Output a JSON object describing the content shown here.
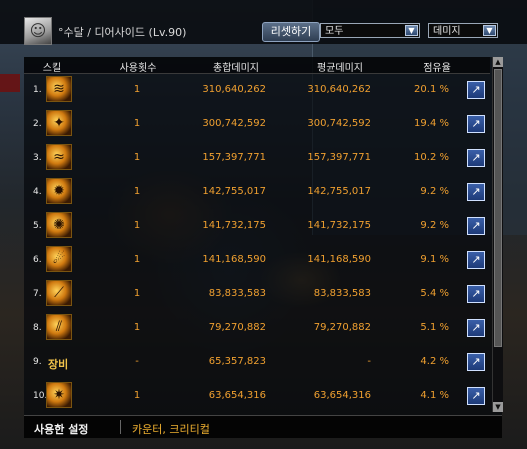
{
  "header": {
    "character": "°수달 / 디어사이드 (Lv.90)",
    "reset_label": "리셋하기",
    "filter_select": "모두",
    "metric_select": "데미지"
  },
  "table": {
    "columns": [
      "스킬",
      "사용횟수",
      "총합데미지",
      "평균데미지",
      "점유율"
    ],
    "rows": [
      {
        "rank": "1.",
        "icon": "fire-claw-icon",
        "skill_text": "",
        "uses": "1",
        "total": "310,640,262",
        "avg": "310,640,262",
        "share": "20.1 %"
      },
      {
        "rank": "2.",
        "icon": "dragon-head-icon",
        "skill_text": "",
        "uses": "1",
        "total": "300,742,592",
        "avg": "300,742,592",
        "share": "19.4 %"
      },
      {
        "rank": "3.",
        "icon": "slash-wave-icon",
        "skill_text": "",
        "uses": "1",
        "total": "157,397,771",
        "avg": "157,397,771",
        "share": "10.2 %"
      },
      {
        "rank": "4.",
        "icon": "burst-icon",
        "skill_text": "",
        "uses": "1",
        "total": "142,755,017",
        "avg": "142,755,017",
        "share": "9.2 %"
      },
      {
        "rank": "5.",
        "icon": "swirl-icon",
        "skill_text": "",
        "uses": "1",
        "total": "141,732,175",
        "avg": "141,732,175",
        "share": "9.2 %"
      },
      {
        "rank": "6.",
        "icon": "flame-swirl-icon",
        "skill_text": "",
        "uses": "1",
        "total": "141,168,590",
        "avg": "141,168,590",
        "share": "9.1 %"
      },
      {
        "rank": "7.",
        "icon": "blade-arc-icon",
        "skill_text": "",
        "uses": "1",
        "total": "83,833,583",
        "avg": "83,833,583",
        "share": "5.4 %"
      },
      {
        "rank": "8.",
        "icon": "claw-strike-icon",
        "skill_text": "",
        "uses": "1",
        "total": "79,270,882",
        "avg": "79,270,882",
        "share": "5.1 %"
      },
      {
        "rank": "9.",
        "icon": "",
        "skill_text": "장비",
        "uses": "-",
        "total": "65,357,823",
        "avg": "-",
        "share": "4.2 %"
      },
      {
        "rank": "10.",
        "icon": "fire-burst-icon",
        "skill_text": "",
        "uses": "1",
        "total": "63,654,316",
        "avg": "63,654,316",
        "share": "4.1 %"
      }
    ]
  },
  "footer": {
    "label": "사용한 설정",
    "value": "카운터, 크리티컬"
  },
  "colors": {
    "value_orange": "#f0a030",
    "share_button_blue": "#2a4d94",
    "header_bg": "#08090e"
  }
}
